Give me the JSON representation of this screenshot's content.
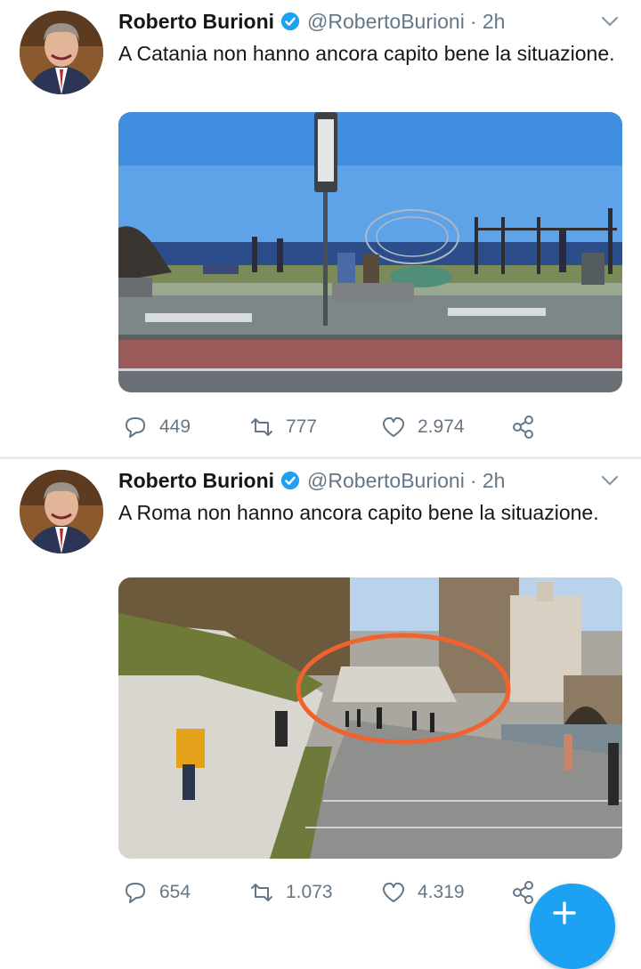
{
  "colors": {
    "accent": "#1da1f2",
    "secondary_text": "#657786",
    "annotation_circle": "#f0622e"
  },
  "tweets": [
    {
      "author": {
        "name": "Roberto Burioni",
        "verified_icon": "verified-badge-icon",
        "handle": "@RobertoBurioni",
        "time": "· 2h"
      },
      "text": "A Catania non hanno ancora capito bene la situazione.",
      "stats": {
        "replies": "449",
        "retweets": "777",
        "likes": "2.974"
      }
    },
    {
      "author": {
        "name": "Roberto Burioni",
        "verified_icon": "verified-badge-icon",
        "handle": "@RobertoBurioni",
        "time": "· 2h"
      },
      "text": "A Roma non hanno ancora capito bene la situazione.",
      "stats": {
        "replies": "654",
        "retweets": "1.073",
        "likes": "4.319"
      }
    }
  ],
  "icons": {
    "reply": "reply-icon",
    "retweet": "retweet-icon",
    "like": "heart-icon",
    "share": "share-icon",
    "more": "chevron-down-icon",
    "compose": "compose-tweet-icon"
  }
}
